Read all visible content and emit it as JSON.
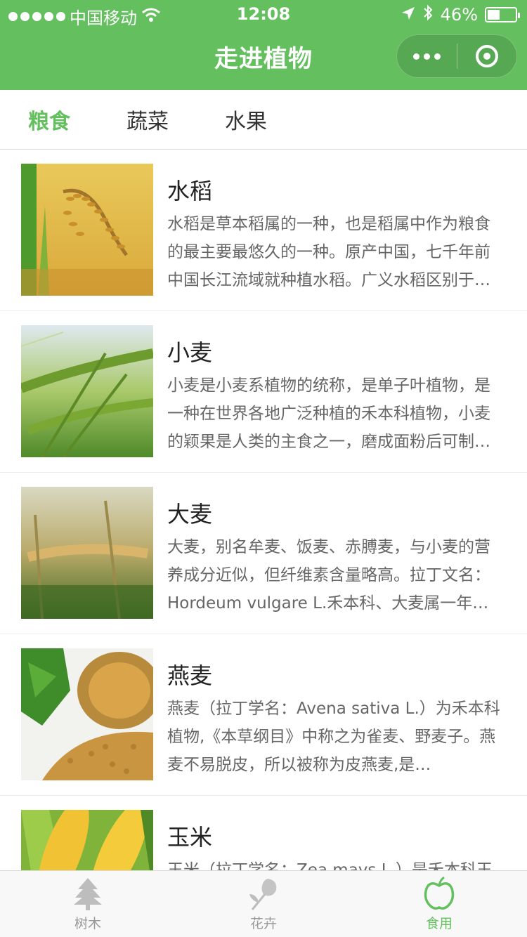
{
  "status_bar": {
    "carrier": "中国移动",
    "time": "12:08",
    "battery": "46%",
    "battery_level": 0.46
  },
  "nav": {
    "title": "走进植物"
  },
  "tabs": [
    {
      "label": "粮食",
      "active": true
    },
    {
      "label": "蔬菜",
      "active": false
    },
    {
      "label": "水果",
      "active": false
    }
  ],
  "items": [
    {
      "title": "水稻",
      "desc": "水稻是草本稻属的一种，也是稻属中作为粮食的最主要最悠久的一种。原产中国，七千年前中国长江流域就种植水稻。广义水稻区别于陆稻…",
      "image": "rice-photo"
    },
    {
      "title": "小麦",
      "desc": "小麦是小麦系植物的统称，是单子叶植物，是一种在世界各地广泛种植的禾本科植物，小麦的颖果是人类的主食之一，磨成面粉后可制…",
      "image": "wheat-photo"
    },
    {
      "title": "大麦",
      "desc": "大麦，别名牟麦、饭麦、赤膊麦，与小麦的营养成分近似，但纤维素含量略高。拉丁文名：Hordeum vulgare L.禾本科、大麦属一年…",
      "image": "barley-photo"
    },
    {
      "title": "燕麦",
      "desc": "燕麦（拉丁学名：Avena sativa L.）为禾本科植物,《本草纲目》中称之为雀麦、野麦子。燕麦不易脱皮，所以被称为皮燕麦,是…",
      "image": "oats-photo"
    },
    {
      "title": "玉米",
      "desc": "玉米（拉丁学名：Zea mays L.）是禾本科玉米属一年生草本植物…",
      "image": "corn-photo"
    }
  ],
  "tabbar": [
    {
      "label": "树木",
      "icon": "tree-icon",
      "active": false
    },
    {
      "label": "花卉",
      "icon": "flower-icon",
      "active": false
    },
    {
      "label": "食用",
      "icon": "apple-icon",
      "active": true
    }
  ],
  "colors": {
    "accent": "#64c05f",
    "inactive": "#999999"
  }
}
